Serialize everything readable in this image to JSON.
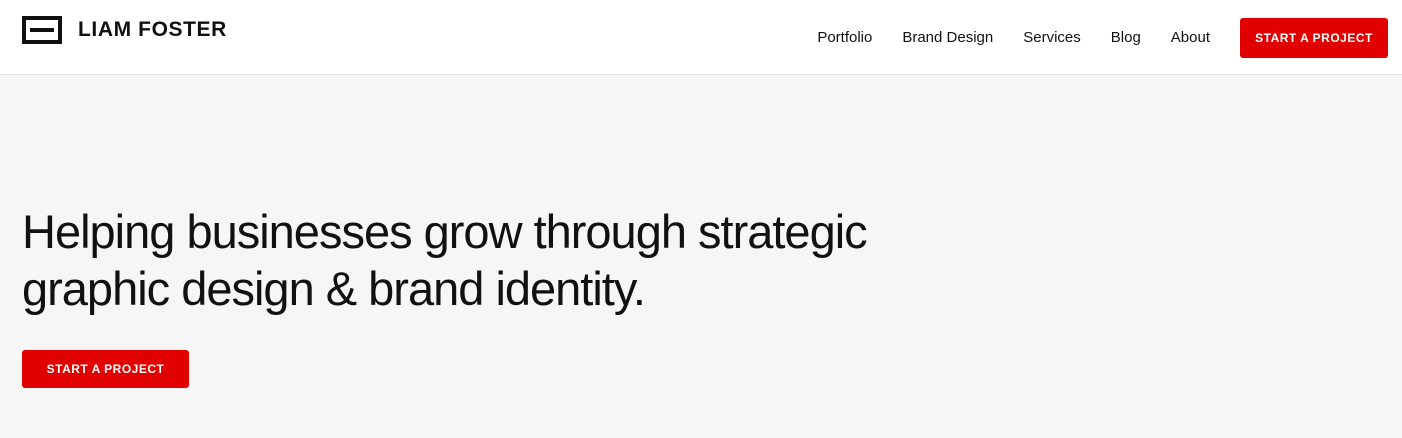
{
  "header": {
    "logo_text": "LIAM FOSTER",
    "logo_icon": "le-monogram-icon",
    "nav": [
      {
        "label": "Portfolio"
      },
      {
        "label": "Brand Design"
      },
      {
        "label": "Services"
      },
      {
        "label": "Blog"
      },
      {
        "label": "About"
      }
    ],
    "cta_label": "START A PROJECT"
  },
  "hero": {
    "title_line1": "Helping businesses grow through strategic",
    "title_line2": "graphic design & brand identity.",
    "cta_label": "START A PROJECT"
  },
  "colors": {
    "accent": "#e00000",
    "header_bg": "#ffffff",
    "hero_bg": "#f6f6f6",
    "text": "#111111"
  }
}
